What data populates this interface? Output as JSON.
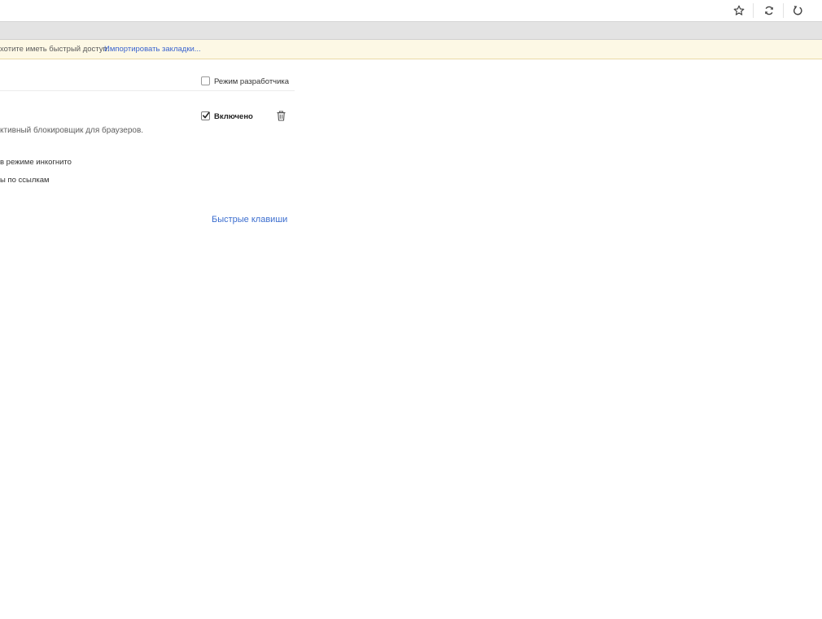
{
  "infobar": {
    "message": "хотите иметь быстрый доступ.",
    "import_link": "Импортировать закладки..."
  },
  "header": {
    "dev_mode_label": "Режим разработчика",
    "dev_mode_checked": false
  },
  "extension": {
    "enabled_label": "Включено",
    "enabled_checked": true,
    "description": "ктивный блокировщик для браузеров.",
    "option_incognito": "в режиме инкогнито",
    "option_file_urls": "ы по ссылкам"
  },
  "footer": {
    "shortcuts_link": "Быстрые клавиши"
  },
  "toolbar": {
    "icons": [
      "star-icon",
      "sync-icon",
      "reload-icon"
    ]
  }
}
